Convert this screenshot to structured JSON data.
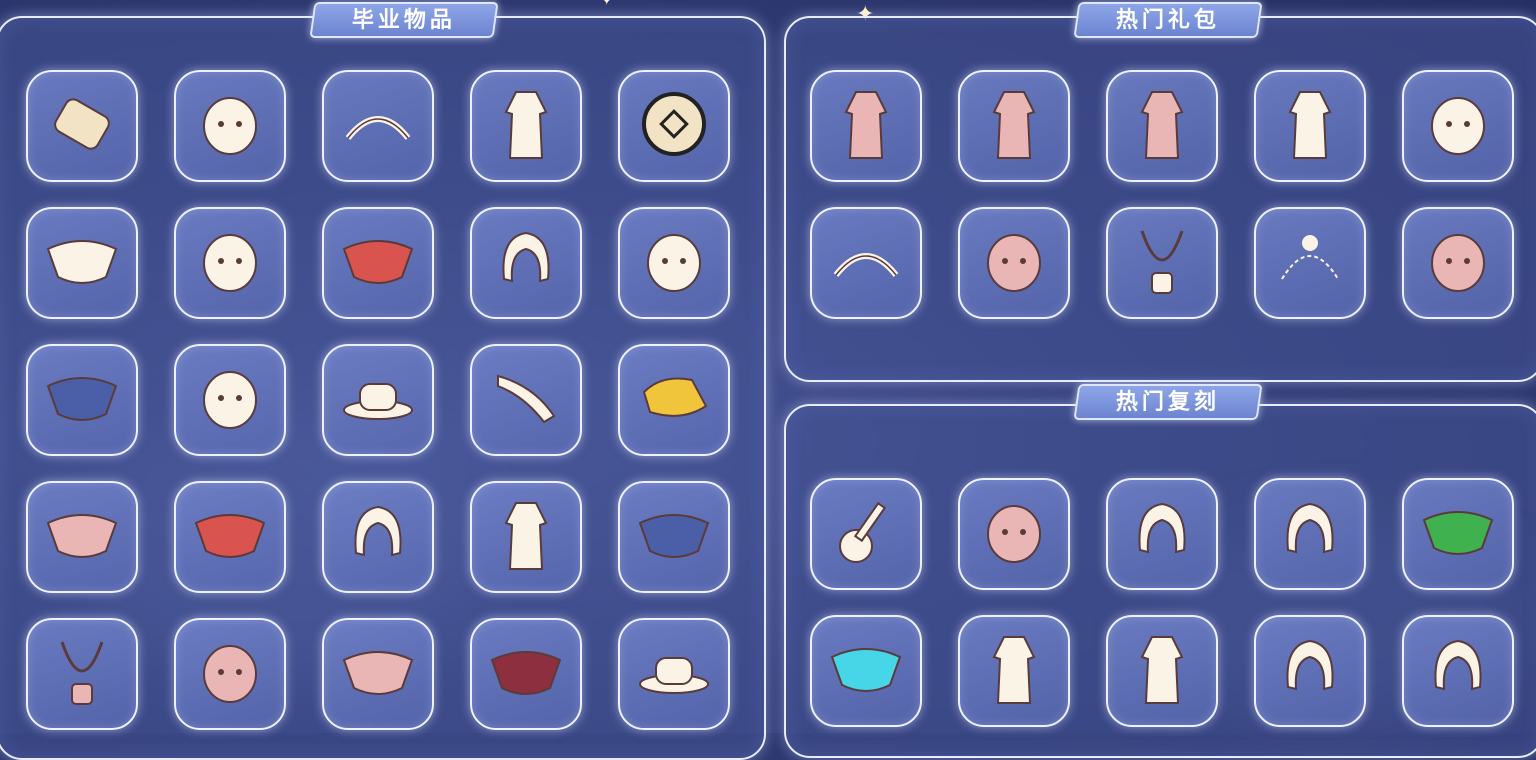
{
  "panels": {
    "graduation": {
      "title": "毕业物品",
      "items": [
        {
          "icon": "scroll-icon"
        },
        {
          "icon": "helmet-mask-icon"
        },
        {
          "icon": "winged-headband-icon"
        },
        {
          "icon": "outfit-icon"
        },
        {
          "icon": "medallion-icon"
        },
        {
          "icon": "white-cape-icon"
        },
        {
          "icon": "ornate-mask-icon"
        },
        {
          "icon": "red-cape-icon"
        },
        {
          "icon": "cat-ear-hair-icon"
        },
        {
          "icon": "horned-mask-icon"
        },
        {
          "icon": "blue-cape-icon"
        },
        {
          "icon": "round-mask-icon"
        },
        {
          "icon": "white-hat-icon"
        },
        {
          "icon": "horn-instrument-icon"
        },
        {
          "icon": "yellow-fur-icon"
        },
        {
          "icon": "pink-bow-cape-icon"
        },
        {
          "icon": "dark-layered-cape-icon"
        },
        {
          "icon": "white-hair-icon"
        },
        {
          "icon": "wrapped-outfit-icon"
        },
        {
          "icon": "blue-butterfly-cape-icon"
        },
        {
          "icon": "scarf-necklace-icon"
        },
        {
          "icon": "orbit-mask-icon"
        },
        {
          "icon": "shell-cape-icon"
        },
        {
          "icon": "crimson-cape-icon"
        },
        {
          "icon": "cowboy-hat-icon"
        }
      ]
    },
    "hot_packs": {
      "title": "热门礼包",
      "items": [
        {
          "icon": "pink-robe-icon"
        },
        {
          "icon": "pink-pants-outfit-icon"
        },
        {
          "icon": "pink-gown-icon"
        },
        {
          "icon": "white-dress-icon"
        },
        {
          "icon": "white-creature-icon"
        },
        {
          "icon": "moon-star-headband-icon"
        },
        {
          "icon": "round-face-mask-icon"
        },
        {
          "icon": "bow-necklace-icon"
        },
        {
          "icon": "cat-outline-icon"
        },
        {
          "icon": "bear-mask-icon"
        }
      ]
    },
    "hot_reruns": {
      "title": "热门复刻",
      "items": [
        {
          "icon": "guitar-icon"
        },
        {
          "icon": "blush-mask-icon"
        },
        {
          "icon": "twin-tail-hair-icon"
        },
        {
          "icon": "ponytail-hair-icon"
        },
        {
          "icon": "green-leaf-cape-icon"
        },
        {
          "icon": "cyan-wave-cape-icon"
        },
        {
          "icon": "outfit-with-sword-icon"
        },
        {
          "icon": "white-pants-icon"
        },
        {
          "icon": "curly-hair-icon"
        },
        {
          "icon": "short-hair-icon"
        }
      ]
    }
  },
  "colors": {
    "background": "#2c3670",
    "panel_border": "#e9ecff",
    "title_bg": "#7d95dc",
    "slot_bg": "#6c7cc2"
  }
}
